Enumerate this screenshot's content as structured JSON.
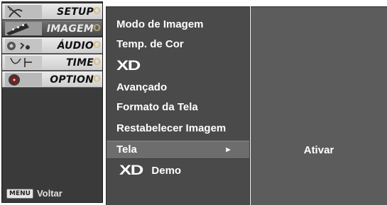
{
  "side_menu": {
    "items": [
      {
        "label": "SETUP",
        "tail": "O",
        "icon": "satellite-dish-icon",
        "active": false
      },
      {
        "label": "IMAGEM",
        "tail": "O",
        "icon": "film-strip-icon",
        "active": true
      },
      {
        "label": "ÁUDIO",
        "tail": "O",
        "icon": "speaker-icon",
        "active": false
      },
      {
        "label": "TIME",
        "tail": "O",
        "icon": "clock-icon",
        "active": false
      },
      {
        "label": "OPTION",
        "tail": "O",
        "icon": "option-disc-icon",
        "active": false
      }
    ],
    "footer": {
      "key": "MENU",
      "text": "Voltar"
    }
  },
  "sub_menu": {
    "items": [
      {
        "label": "Modo de Imagem"
      },
      {
        "label": "Temp. de Cor"
      },
      {
        "label": "XD"
      },
      {
        "label": "Avançado"
      },
      {
        "label": "Formato da Tela"
      },
      {
        "label": "Restabelecer Imagem"
      },
      {
        "label": "Tela",
        "arrow": "►"
      },
      {
        "logo": "XD",
        "label": "Demo"
      }
    ]
  },
  "value_panel": {
    "text": "Ativar"
  },
  "colors": {
    "background": "#3a3a3a",
    "active_tab": "#5a5a5a",
    "selected_row": "#6d6d6d",
    "text": "#ffffff"
  }
}
